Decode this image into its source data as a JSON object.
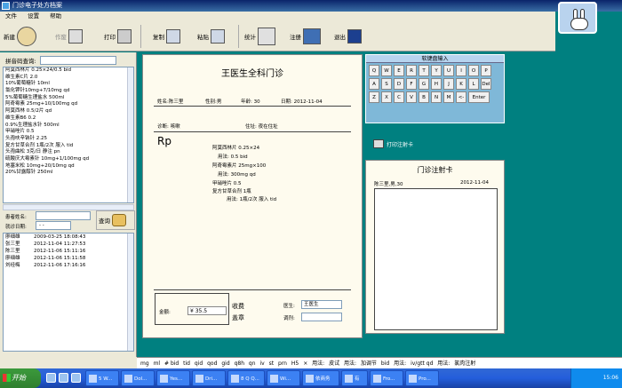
{
  "window": {
    "title": "门诊电子处方档案"
  },
  "menu": [
    "文件",
    "设置",
    "帮助"
  ],
  "toolbar": {
    "new": "新建",
    "void": "作废",
    "print": "打印",
    "copy": "复制",
    "paste": "粘贴",
    "stats": "统计",
    "register": "注册",
    "exit": "退出"
  },
  "left": {
    "drug_search_label": "拼音码查询:",
    "drugs": [
      "阿莫西林片 0.25×24/0.5 bid",
      "维生素C片 2.0",
      "10%葡萄糖针 10ml",
      "氯化钾针10mg+7/10mg qd",
      "5%葡萄糖生理盐水 500ml",
      "阿奇霉素 25mg+10/100mg qd",
      "阿莫西林 0.5/2片 qd",
      "维生素B6 0.2",
      "0.9%生理盐水针 500ml",
      "甲硝唑片 0.5",
      "头孢呋辛钠针 2.25",
      "复方甘草合剂 1瓶/2次 服入 tid",
      "头孢曲松 3克/日 静注 pn",
      "硫酸庆大霉素针 10mg+1/100mg qd",
      "地塞米松 10mg+20/10mg qd",
      "20%甘露醇针 250ml"
    ],
    "patient_name_label": "患者姓名:",
    "visit_date_label": "就诊日期:",
    "visit_date_value": "- -",
    "query_button": "查询",
    "patients": [
      {
        "name": "廖细雄",
        "time": "2009-03-25 18:08:43"
      },
      {
        "name": "张三里",
        "time": "2012-11-04 11:27:53"
      },
      {
        "name": "陈三里",
        "time": "2012-11-06 15:11:16"
      },
      {
        "name": "廖细雄",
        "time": "2012-11-06 15:11:58"
      },
      {
        "name": "刘经梅",
        "time": "2012-11-06 17:16:16"
      }
    ]
  },
  "rx": {
    "title": "王医生全科门诊",
    "name_label": "姓名:",
    "name": "陈三里",
    "sex_label": "性别:",
    "sex": "男",
    "age_label": "年龄:",
    "age": "30",
    "date_label": "日期:",
    "date": "2012-11-04",
    "diag_label": "诊断:",
    "diag": "咳嗽",
    "addr_label": "住址:",
    "addr": "夜在住址",
    "rp": "Rp",
    "lines": [
      "阿莫西林片 0.25×24",
      "用法: 0.5 bid",
      "阿奇霉素片 25mg×100",
      "用法: 300mg qd",
      "甲硝唑片 0.5",
      "复方甘草合剂 1瓶",
      "用法: 1瓶/2次 服入 tid"
    ],
    "amount_label": "金额:",
    "amount": "¥    35.5",
    "fee_label": "收费",
    "stamp_label": "盖章",
    "doctor_label": "医生:",
    "doctor": "王医生",
    "checker_label": "调剂:"
  },
  "keyboard": {
    "title": "软键盘输入",
    "rows": [
      [
        "Q",
        "W",
        "E",
        "R",
        "T",
        "Y",
        "U",
        "I",
        "O",
        "P"
      ],
      [
        "A",
        "S",
        "D",
        "F",
        "G",
        "H",
        "J",
        "K",
        "L",
        "Del"
      ],
      [
        "Z",
        "X",
        "C",
        "V",
        "B",
        "N",
        "M",
        "<-",
        "Enter"
      ]
    ]
  },
  "print_card": "打印注射卡",
  "injection": {
    "title": "门诊注射卡",
    "patient": "陈三里,男,30",
    "date": "2012-11-04"
  },
  "shortcuts": [
    "mg",
    "ml",
    "# bid",
    "tid",
    "qid",
    "qod",
    "gid",
    "q8h",
    "qn",
    "iv",
    "st",
    "prn",
    "H5",
    "×",
    "用法:",
    "皮试",
    "用法:",
    "加调节",
    "bid",
    "用法:",
    "iv/gtt qd",
    "用法:",
    "氯肉注射"
  ],
  "taskbar": {
    "start": "开始",
    "tasks": [
      "5 W...",
      "Dol...",
      "Yes...",
      "Dri...",
      "8 Q Q...",
      "Wi...",
      "依商务",
      "有",
      "Fro...",
      "Pro..."
    ],
    "clock": "15:06"
  }
}
